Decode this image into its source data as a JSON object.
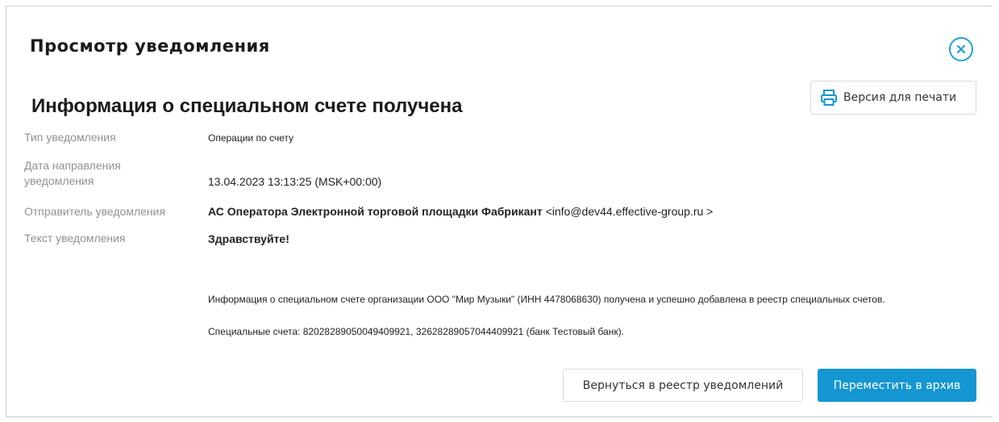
{
  "modal": {
    "title": "Просмотр уведомления",
    "close_icon": "close-circle-icon"
  },
  "notification": {
    "title": "Информация о специальном счете получена",
    "print_label": "Версия для печати",
    "print_icon": "printer-icon",
    "fields": {
      "type_label": "Тип уведомления",
      "type_value": "Операции по счету",
      "date_label_line1": "Дата направления",
      "date_label_line2": "уведомления",
      "date_value": "13.04.2023 13:13:25 (MSK+00:00)",
      "sender_label": "Отправитель уведомления",
      "sender_name": "АС Оператора Электронной торговой площадки Фабрикант",
      "sender_email": " <info@dev44.effective-group.ru >",
      "text_label": "Текст уведомления",
      "greeting": "Здравствуйте!",
      "paragraph1": "Информация о специальном счете организации ООО \"Мир Музыки\" (ИНН 4478068630) получена и успешно добавлена в реестр специальных счетов.",
      "paragraph2": "Специальные счета: 82028289050049409921, 32628289057044409921 (банк Тестовый банк)."
    }
  },
  "actions": {
    "back_label": "Вернуться в реестр уведомлений",
    "archive_label": "Переместить в архив"
  },
  "colors": {
    "accent": "#1496d2",
    "close_accent": "#1aa3d9",
    "label_gray": "#8e9196"
  }
}
